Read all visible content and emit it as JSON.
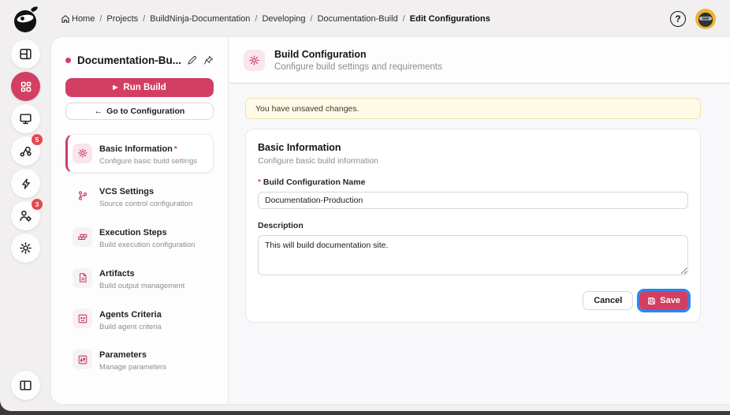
{
  "colors": {
    "accent": "#d23f63",
    "accent_light_bg": "#f9e5eb",
    "badge_red": "#e5484d",
    "focus_ring_blue": "#2b87f0",
    "banner_bg": "#fefae7",
    "banner_border": "#eee3a5"
  },
  "topbar": {
    "breadcrumb": [
      {
        "label": "Home"
      },
      {
        "label": "Projects"
      },
      {
        "label": "BuildNinja-Documentation"
      },
      {
        "label": "Developing"
      },
      {
        "label": "Documentation-Build"
      },
      {
        "label": "Edit Configurations"
      }
    ],
    "separator": "/",
    "help_label": "?"
  },
  "rail": {
    "badges": {
      "builds": "5",
      "users": "3"
    }
  },
  "sidebar": {
    "title": "Documentation-Bu...",
    "run_build_label": "Run Build",
    "run_play_glyph": "▶",
    "goto_arrow": "←",
    "goto_label": "Go to Configuration",
    "nav": [
      {
        "label": "Basic Information",
        "required_mark": "*",
        "desc": "Configure basic build settings"
      },
      {
        "label": "VCS Settings",
        "desc": "Source control configuration"
      },
      {
        "label": "Execution Steps",
        "desc": "Build execution configuration"
      },
      {
        "label": "Artifacts",
        "desc": "Build output management"
      },
      {
        "label": "Agents Criteria",
        "desc": "Build agent criteria"
      },
      {
        "label": "Parameters",
        "desc": "Manage parameters"
      }
    ]
  },
  "main": {
    "header": {
      "title": "Build Configuration",
      "subtitle": "Configure build settings and requirements"
    },
    "banner_text": "You have unsaved changes.",
    "form": {
      "title": "Basic Information",
      "subtitle": "Configure basic build information",
      "required_mark": "*",
      "name_label": "Build Configuration Name",
      "name_value": "Documentation-Production",
      "description_label": "Description",
      "description_value": "This will build documentation site.",
      "cancel_label": "Cancel",
      "save_label": "Save"
    }
  }
}
